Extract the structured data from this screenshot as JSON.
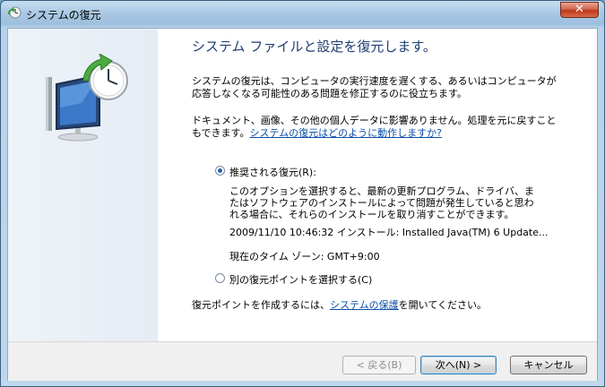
{
  "window": {
    "title": "システムの復元",
    "close_label": "✕"
  },
  "heading": "システム ファイルと設定を復元します。",
  "desc1": "システムの復元は、コンピュータの実行速度を遅くする、あるいはコンピュータが応答しなくなる可能性のある問題を修正するのに役立ちます。",
  "desc2_text": "ドキュメント、画像、その他の個人データに影響ありません。処理を元に戻すこともできます。",
  "desc2_link": "システムの復元はどのように動作しますか?",
  "options": {
    "recommended_label": "推奨される復元(R):",
    "recommended_selected": true,
    "recommended_description": "このオプションを選択すると、最新の更新プログラム、ドライバ、またはソフトウェアのインストールによって問題が発生していると思われる場合に、それらのインストールを取り消すことができます。",
    "restore_point": "2009/11/10 10:46:32 インストール: Installed Java(TM) 6 Update...",
    "timezone": "現在のタイム ゾーン: GMT+9:00",
    "other_label": "別の復元ポイントを選択する(C)",
    "other_selected": false
  },
  "footer_note_prefix": "復元ポイントを作成するには、",
  "footer_note_link": "システムの保護",
  "footer_note_suffix": "を開いてください。",
  "buttons": {
    "back": "< 戻る(B)",
    "next": "次へ(N) >",
    "cancel": "キャンセル"
  },
  "colors": {
    "heading": "#1f3f70",
    "link": "#0b4fa8",
    "radio_dot": "#2b5fb0"
  }
}
